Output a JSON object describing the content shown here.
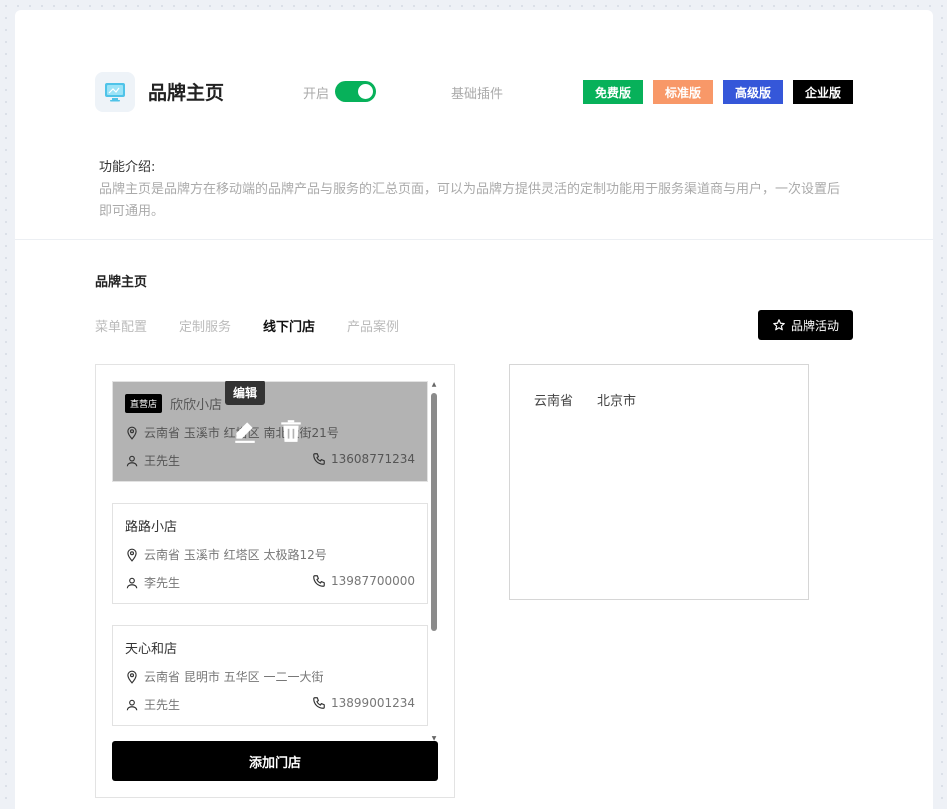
{
  "header": {
    "title": "品牌主页",
    "switch_label": "开启",
    "switch_on": true,
    "plugin_type": "基础插件",
    "tiers": [
      "免费版",
      "标准版",
      "高级版",
      "企业版"
    ]
  },
  "intro": {
    "label": "功能介绍:",
    "text": "品牌主页是品牌方在移动端的品牌产品与服务的汇总页面，可以为品牌方提供灵活的定制功能用于服务渠道商与用户，一次设置后即可通用。"
  },
  "section": {
    "title": "品牌主页",
    "tabs": [
      "菜单配置",
      "定制服务",
      "线下门店",
      "产品案例"
    ],
    "active_tab": "线下门店",
    "activity_button": "品牌活动"
  },
  "stores": [
    {
      "badge": "直营店",
      "name": "欣欣小店",
      "address": "云南省 玉溪市 红塔区 南北大街21号",
      "contact": "王先生",
      "phone": "13608771234"
    },
    {
      "name": "路路小店",
      "address": "云南省 玉溪市 红塔区 太极路12号",
      "contact": "李先生",
      "phone": "13987700000"
    },
    {
      "name": "天心和店",
      "address": "云南省 昆明市 五华区 一二一大街",
      "contact": "王先生",
      "phone": "13899001234"
    }
  ],
  "hover_tooltip": "编辑",
  "add_store_label": "添加门店",
  "region": {
    "province": "云南省",
    "city": "北京市"
  },
  "colors": {
    "green": "#07b15a",
    "orange": "#f89868",
    "blue": "#3557d9",
    "black": "#000000"
  }
}
